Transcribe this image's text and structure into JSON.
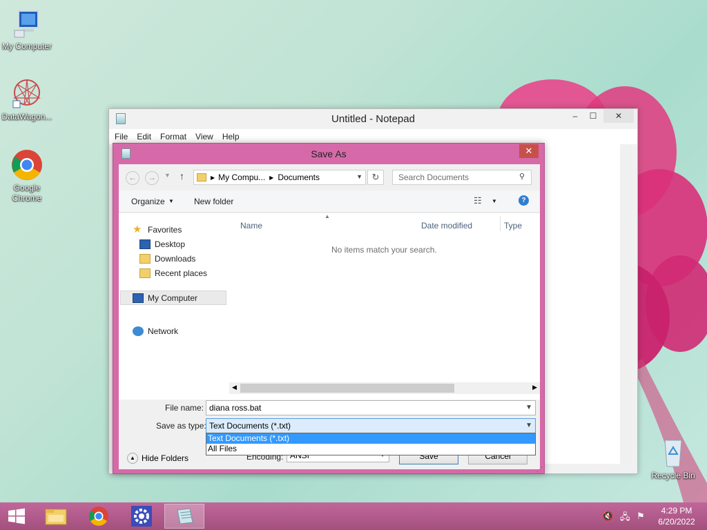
{
  "desktop": {
    "icons": [
      {
        "label": "My Computer",
        "icon": "computer-icon"
      },
      {
        "label": "DataWagon...",
        "icon": "datawagon-icon"
      },
      {
        "label": "Google Chrome",
        "icon": "chrome-icon"
      },
      {
        "label": "Recycle Bin",
        "icon": "recycle-bin-icon"
      }
    ]
  },
  "notepad": {
    "title": "Untitled - Notepad",
    "menu": [
      "File",
      "Edit",
      "Format",
      "View",
      "Help"
    ],
    "controls": {
      "minimize": "–",
      "maximize": "☐",
      "close": "✕"
    }
  },
  "save_as": {
    "title": "Save As",
    "close": "✕",
    "breadcrumb": [
      "My Compu...",
      "Documents"
    ],
    "search_placeholder": "Search Documents",
    "toolbar": {
      "organize": "Organize",
      "new_folder": "New folder"
    },
    "nav_pane": {
      "favorites": "Favorites",
      "desktop": "Desktop",
      "downloads": "Downloads",
      "recent": "Recent places",
      "my_computer": "My Computer",
      "network": "Network"
    },
    "columns": {
      "name": "Name",
      "date_modified": "Date modified",
      "type": "Type"
    },
    "empty_message": "No items match your search.",
    "file_name_label": "File name:",
    "file_name_value": "diana ross.bat",
    "save_type_label": "Save as type:",
    "save_type_value": "Text Documents (*.txt)",
    "save_type_options": [
      "Text Documents (*.txt)",
      "All Files"
    ],
    "encoding_label": "Encoding:",
    "encoding_value": "ANSI",
    "hide_folders": "Hide Folders",
    "save_button": "Save",
    "cancel_button": "Cancel"
  },
  "taskbar": {
    "time": "4:29 PM",
    "date": "6/20/2022"
  },
  "colors": {
    "dialog_frame": "#d66aa9",
    "taskbar": "#b25c8a",
    "selection": "#3399ff"
  }
}
